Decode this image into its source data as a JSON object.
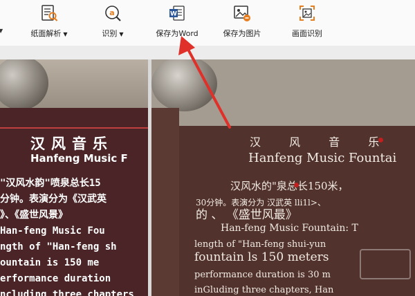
{
  "toolbar": {
    "items": [
      {
        "label": "纸面解析",
        "icon": "document-analyze-icon",
        "has_arrow": true
      },
      {
        "label": "识别",
        "icon": "recognize-icon",
        "has_arrow": true
      },
      {
        "label": "保存为Word",
        "icon": "word-icon",
        "has_arrow": false
      },
      {
        "label": "保存为图片",
        "icon": "image-icon",
        "has_arrow": false
      },
      {
        "label": "画面识别",
        "icon": "screen-capture-icon",
        "has_arrow": false
      }
    ],
    "dropdown_arrow": "▼"
  },
  "left_image": {
    "title": "汉风音乐",
    "subtitle": "Hanfeng Music F",
    "lines": [
      "\"汉风水韵\"喷泉总长15",
      "分钟。表演分为《汉武英",
      "》、《盛世风景》",
      "Han-feng Music Fou",
      "ngth of \"Han-feng sh",
      "ountain is 150 me",
      "erformance duration",
      "ncluding three chapters"
    ]
  },
  "right_image": {
    "title": "汉 风 音 乐 ",
    "subtitle": "Hanfeng Music Fountai",
    "lines": [
      "汉风水的\"泉总长150米，",
      "30分钟。表演分为 汉武英 lli1l>、",
      "的   、   《盛世风最》",
      "Han-feng Music Fountain: T",
      "length  of  \"Han-feng  shui-yun",
      "fountain  ls  150  meters",
      "performance duration is 30 m",
      "inGluding three chapters, Han"
    ]
  },
  "colors": {
    "plaque_left": "#4a2426",
    "plaque_right": "#51322c",
    "accent_red": "#c0201f",
    "word_blue": "#2b579a",
    "icon_orange": "#e87d1e"
  }
}
